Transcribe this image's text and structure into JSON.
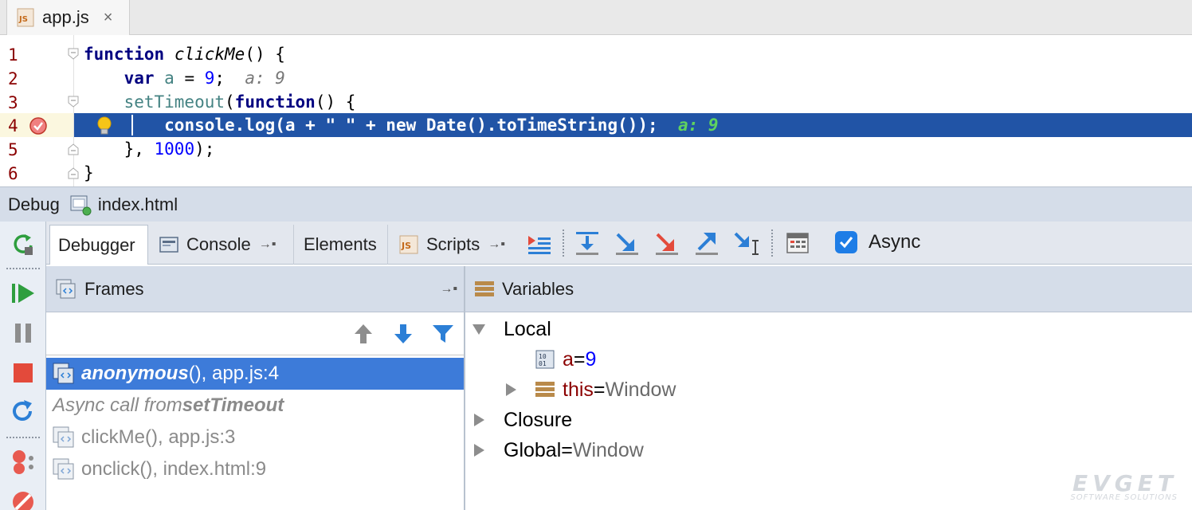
{
  "editor_tab": {
    "file_type_icon": "javascript-file-icon",
    "label": "app.js",
    "close_glyph": "×"
  },
  "code": {
    "line_numbers": [
      "1",
      "2",
      "3",
      "4",
      "5",
      "6"
    ],
    "line1": {
      "kw": "function",
      "name": "clickMe",
      "rest": "() {"
    },
    "line2": {
      "indent": "    ",
      "kw": "var",
      "var": "a",
      "op": " = ",
      "num": "9",
      "semi": ";",
      "hint": "a: 9"
    },
    "line3": {
      "indent": "    ",
      "call": "setTimeout",
      "open": "(",
      "kw": "function",
      "rest": "() {"
    },
    "line4": {
      "indent": "        ",
      "text": "console.log(a + \" \" + new Date().toTimeString());",
      "hint": "a: 9"
    },
    "line5": {
      "indent": "    ",
      "pre": "}, ",
      "num": "1000",
      "post": ");"
    },
    "line6": {
      "text": "}"
    },
    "current_line_color": "#2154a6"
  },
  "debug_header": {
    "title": "Debug",
    "config_icon": "html-run-config-icon",
    "config": "index.html"
  },
  "debugger_tabs": [
    {
      "label": "Debugger",
      "icon": ""
    },
    {
      "label": "Console",
      "icon": "console-icon",
      "pin": "→▪"
    },
    {
      "label": "Elements",
      "icon": ""
    },
    {
      "label": "Scripts",
      "icon": "javascript-file-icon",
      "pin": "→▪"
    }
  ],
  "toolbar_icons": [
    "show-execution-point-icon",
    "step-over-icon",
    "step-into-icon",
    "force-step-into-icon",
    "step-out-icon",
    "run-to-cursor-icon",
    "evaluate-expression-icon"
  ],
  "async": {
    "label": "Async",
    "checked": true
  },
  "frames": {
    "title": "Frames",
    "pin": "→▪",
    "items": [
      {
        "fn": "anonymous",
        "rest": "(), app.js:4",
        "selected": true
      },
      {
        "async_prefix": "Async call from ",
        "async_fn": "setTimeout"
      },
      {
        "text": "clickMe(), app.js:3"
      },
      {
        "text": "onclick(), index.html:9"
      }
    ]
  },
  "variables": {
    "title": "Variables",
    "groups": [
      {
        "label": "Local",
        "expanded": true
      },
      {
        "name": "a",
        "eq": " = ",
        "value": "9"
      },
      {
        "name": "this",
        "eq": " = ",
        "value": "Window"
      },
      {
        "label": "Closure"
      },
      {
        "label": "Global",
        "eq": " = ",
        "value": "Window"
      }
    ]
  },
  "watermark": {
    "main": "EVGET",
    "sub": "SOFTWARE SOLUTIONS"
  },
  "colors": {
    "accent": "#3d7bd9",
    "panel_header": "#d5dde9",
    "checkbox": "#1e7de6",
    "variable_name": "#8b0000"
  }
}
